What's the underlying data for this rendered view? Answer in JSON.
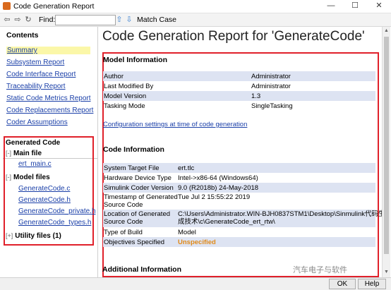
{
  "window": {
    "title": "Code Generation Report",
    "minimize": "—",
    "maximize": "☐",
    "close": "✕"
  },
  "toolbar": {
    "find_label": "Find:",
    "find_value": "",
    "match_case": "Match Case"
  },
  "nav": {
    "contents_title": "Contents",
    "items": [
      "Summary",
      "Subsystem Report",
      "Code Interface Report",
      "Traceability Report",
      "Static Code Metrics Report",
      "Code Replacements Report",
      "Coder Assumptions"
    ]
  },
  "generated_code": {
    "title": "Generated Code",
    "main_file": {
      "label": "Main file",
      "toggle": "[-]",
      "files": [
        "ert_main.c"
      ]
    },
    "model_files": {
      "label": "Model files",
      "toggle": "[-]",
      "files": [
        "GenerateCode.c",
        "GenerateCode.h",
        "GenerateCode_private.h",
        "GenerateCode_types.h"
      ]
    },
    "utility_files": {
      "label": "Utility files (1)",
      "toggle": "[+]"
    }
  },
  "report": {
    "title": "Code Generation Report for 'GenerateCode'",
    "model_info": {
      "heading": "Model Information",
      "rows": [
        [
          "Author",
          "Administrator"
        ],
        [
          "Last Modified By",
          "Administrator"
        ],
        [
          "Model Version",
          "1.3"
        ],
        [
          "Tasking Mode",
          "SingleTasking"
        ]
      ],
      "config_link": "Configuration settings at time of code generation"
    },
    "code_info": {
      "heading": "Code Information",
      "rows": [
        [
          "System Target File",
          "ert.tlc"
        ],
        [
          "Hardware Device Type",
          "Intel->x86-64 (Windows64)"
        ],
        [
          "Simulink Coder Version",
          "9.0 (R2018b) 24-May-2018"
        ],
        [
          "Timestamp of Generated",
          "Tue Jul 2 15:55:22 2019"
        ],
        [
          "Source Code",
          ""
        ],
        [
          "Location of Generated",
          "C:\\Users\\Administrator.WIN-BJH0837STM1\\Desktop\\Sinmulink代码生"
        ],
        [
          "Source Code",
          "成技术\\c\\GenerateCode_ert_rtw\\"
        ],
        [
          "Type of Build",
          "Model"
        ],
        [
          "Objectives Specified",
          "Unspecified"
        ]
      ]
    },
    "additional_heading": "Additional Information"
  },
  "buttons": {
    "ok": "OK",
    "help": "Help"
  },
  "watermark": "汽车电子与软件",
  "colors": {
    "highlight_box": "#e0202a",
    "link": "#1a3fa8",
    "row_alt": "#dde3f2",
    "active_nav": "#fbf7a8",
    "unspecified": "#e08a1a"
  }
}
